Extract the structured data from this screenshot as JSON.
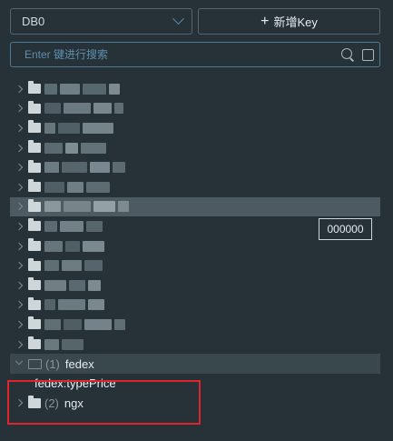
{
  "toolbar": {
    "db_selected": "DB0",
    "new_key_label": "新增Key"
  },
  "search": {
    "placeholder": "Enter 键进行搜索",
    "value": ""
  },
  "tooltip": "000000",
  "tree": {
    "open_folder": {
      "count": "(1)",
      "name": "fedex"
    },
    "child_key": "fedex:typePrice",
    "next_folder": {
      "count": "(2)",
      "name": "ngx"
    }
  },
  "colors": {
    "background": "#263238",
    "highlight": "#4c5b62",
    "annotation_red": "#e0242c",
    "border": "#56656d"
  }
}
